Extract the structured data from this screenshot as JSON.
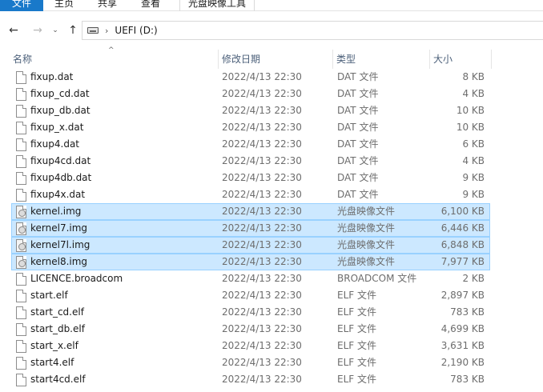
{
  "ribbon": {
    "tabs": [
      "文件",
      "主页",
      "共享",
      "查看",
      "光盘映像工具"
    ]
  },
  "nav": {
    "back_glyph": "←",
    "forward_glyph": "→",
    "recent_glyph": "⌄",
    "up_glyph": "↑",
    "separator": "›",
    "location": "UEFI (D:)"
  },
  "columns": {
    "name": "名称",
    "date": "修改日期",
    "type": "类型",
    "size": "大小",
    "sort_glyph": "^"
  },
  "files": [
    {
      "name": "fixup.dat",
      "date": "2022/4/13 22:30",
      "type": "DAT 文件",
      "size": "8 KB",
      "icon": "file-icon",
      "selected": false
    },
    {
      "name": "fixup_cd.dat",
      "date": "2022/4/13 22:30",
      "type": "DAT 文件",
      "size": "4 KB",
      "icon": "file-icon",
      "selected": false
    },
    {
      "name": "fixup_db.dat",
      "date": "2022/4/13 22:30",
      "type": "DAT 文件",
      "size": "10 KB",
      "icon": "file-icon",
      "selected": false
    },
    {
      "name": "fixup_x.dat",
      "date": "2022/4/13 22:30",
      "type": "DAT 文件",
      "size": "10 KB",
      "icon": "file-icon",
      "selected": false
    },
    {
      "name": "fixup4.dat",
      "date": "2022/4/13 22:30",
      "type": "DAT 文件",
      "size": "6 KB",
      "icon": "file-icon",
      "selected": false
    },
    {
      "name": "fixup4cd.dat",
      "date": "2022/4/13 22:30",
      "type": "DAT 文件",
      "size": "4 KB",
      "icon": "file-icon",
      "selected": false
    },
    {
      "name": "fixup4db.dat",
      "date": "2022/4/13 22:30",
      "type": "DAT 文件",
      "size": "9 KB",
      "icon": "file-icon",
      "selected": false
    },
    {
      "name": "fixup4x.dat",
      "date": "2022/4/13 22:30",
      "type": "DAT 文件",
      "size": "9 KB",
      "icon": "file-icon",
      "selected": false
    },
    {
      "name": "kernel.img",
      "date": "2022/4/13 22:30",
      "type": "光盘映像文件",
      "size": "6,100 KB",
      "icon": "disc-image-icon",
      "selected": true
    },
    {
      "name": "kernel7.img",
      "date": "2022/4/13 22:30",
      "type": "光盘映像文件",
      "size": "6,446 KB",
      "icon": "disc-image-icon",
      "selected": true
    },
    {
      "name": "kernel7l.img",
      "date": "2022/4/13 22:30",
      "type": "光盘映像文件",
      "size": "6,848 KB",
      "icon": "disc-image-icon",
      "selected": true
    },
    {
      "name": "kernel8.img",
      "date": "2022/4/13 22:30",
      "type": "光盘映像文件",
      "size": "7,977 KB",
      "icon": "disc-image-icon",
      "selected": true
    },
    {
      "name": "LICENCE.broadcom",
      "date": "2022/4/13 22:30",
      "type": "BROADCOM 文件",
      "size": "2 KB",
      "icon": "file-icon",
      "selected": false
    },
    {
      "name": "start.elf",
      "date": "2022/4/13 22:30",
      "type": "ELF 文件",
      "size": "2,897 KB",
      "icon": "file-icon",
      "selected": false
    },
    {
      "name": "start_cd.elf",
      "date": "2022/4/13 22:30",
      "type": "ELF 文件",
      "size": "783 KB",
      "icon": "file-icon",
      "selected": false
    },
    {
      "name": "start_db.elf",
      "date": "2022/4/13 22:30",
      "type": "ELF 文件",
      "size": "4,699 KB",
      "icon": "file-icon",
      "selected": false
    },
    {
      "name": "start_x.elf",
      "date": "2022/4/13 22:30",
      "type": "ELF 文件",
      "size": "3,631 KB",
      "icon": "file-icon",
      "selected": false
    },
    {
      "name": "start4.elf",
      "date": "2022/4/13 22:30",
      "type": "ELF 文件",
      "size": "2,190 KB",
      "icon": "file-icon",
      "selected": false
    },
    {
      "name": "start4cd.elf",
      "date": "2022/4/13 22:30",
      "type": "ELF 文件",
      "size": "783 KB",
      "icon": "file-icon",
      "selected": false
    }
  ],
  "colors": {
    "accent": "#1979ca",
    "selection_fill": "#cce8ff",
    "selection_border": "#99d1ff",
    "header_text": "#4c607a"
  }
}
